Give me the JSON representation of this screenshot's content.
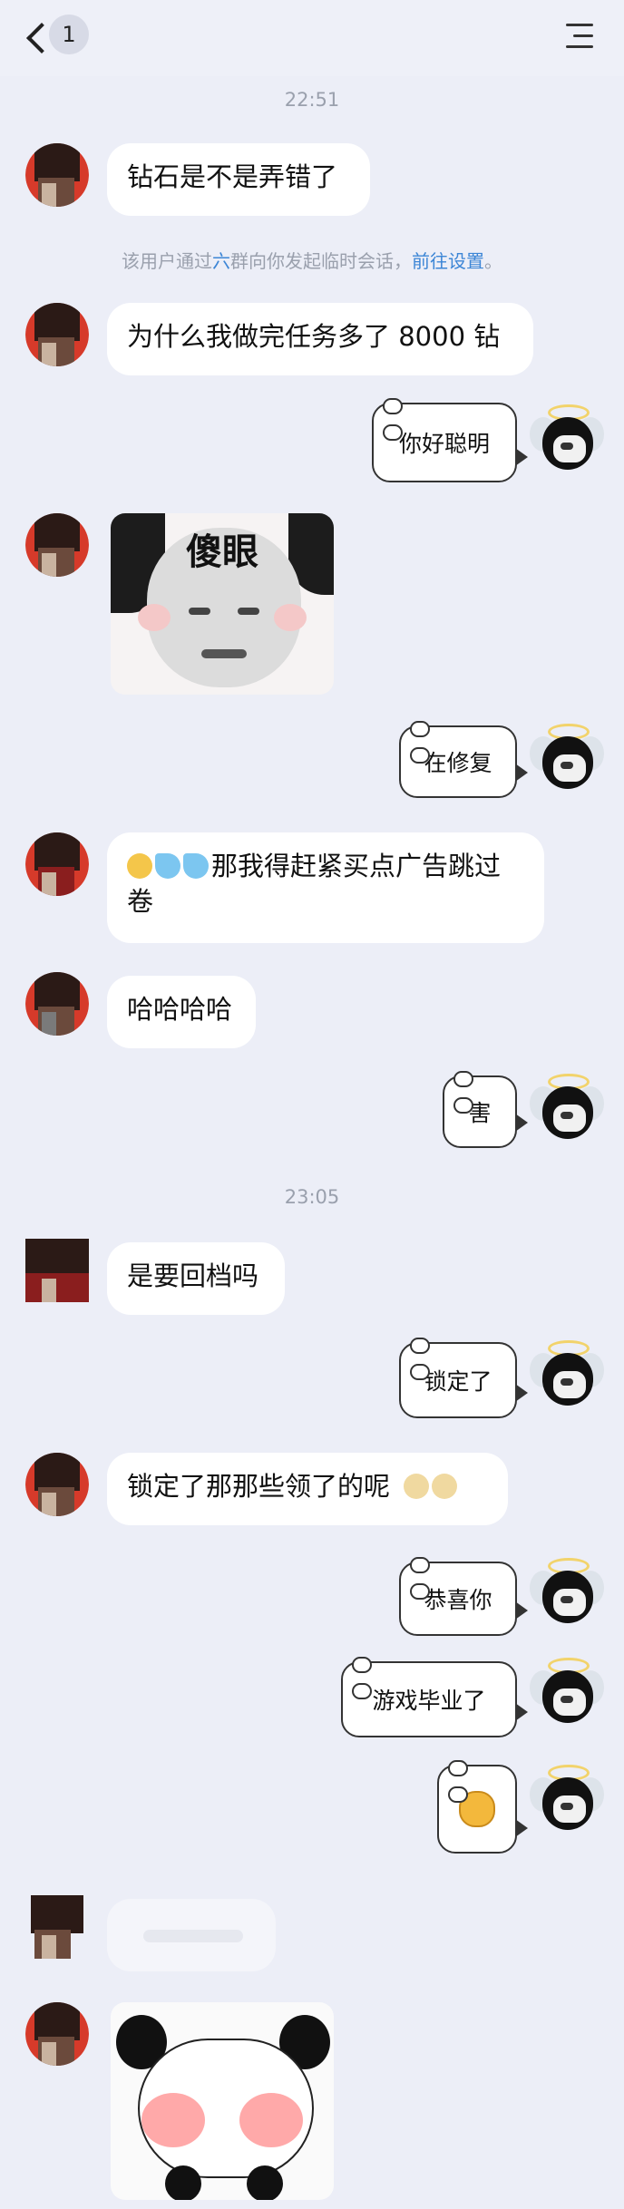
{
  "header": {
    "back_badge": "1"
  },
  "timestamps": {
    "t1": "22:51",
    "t2": "23:05"
  },
  "system_note": {
    "pre": "该用户通过",
    "group": "六",
    "mid": "群向你发起临时会话，",
    "link": "前往设置",
    "post": "。"
  },
  "messages": {
    "m1": "钻石是不是弄错了",
    "m2": "为什么我做完任务多了 8000 钻",
    "m3_stickertext": "傻眼",
    "m4": "那我得赶紧买点广告跳过卷",
    "m5": "哈哈哈哈",
    "m6": "是要回档吗",
    "m7": "锁定了那那些领了的呢"
  },
  "stickers": {
    "s1": "你好聪明",
    "s2": "在修复",
    "s3": "害",
    "s4": "锁定了",
    "s5": "恭喜你",
    "s6": "游戏毕业了"
  },
  "colors": {
    "background": "#eceef7",
    "bubble": "#ffffff",
    "link": "#3d86d6",
    "muted": "#9aa0ad"
  },
  "icons": [
    "back-chevron-icon",
    "menu-icon",
    "grin-emoji-icon",
    "sweat-drops-emoji-icon",
    "face-emoji-icon",
    "dog-emoji-icon"
  ]
}
